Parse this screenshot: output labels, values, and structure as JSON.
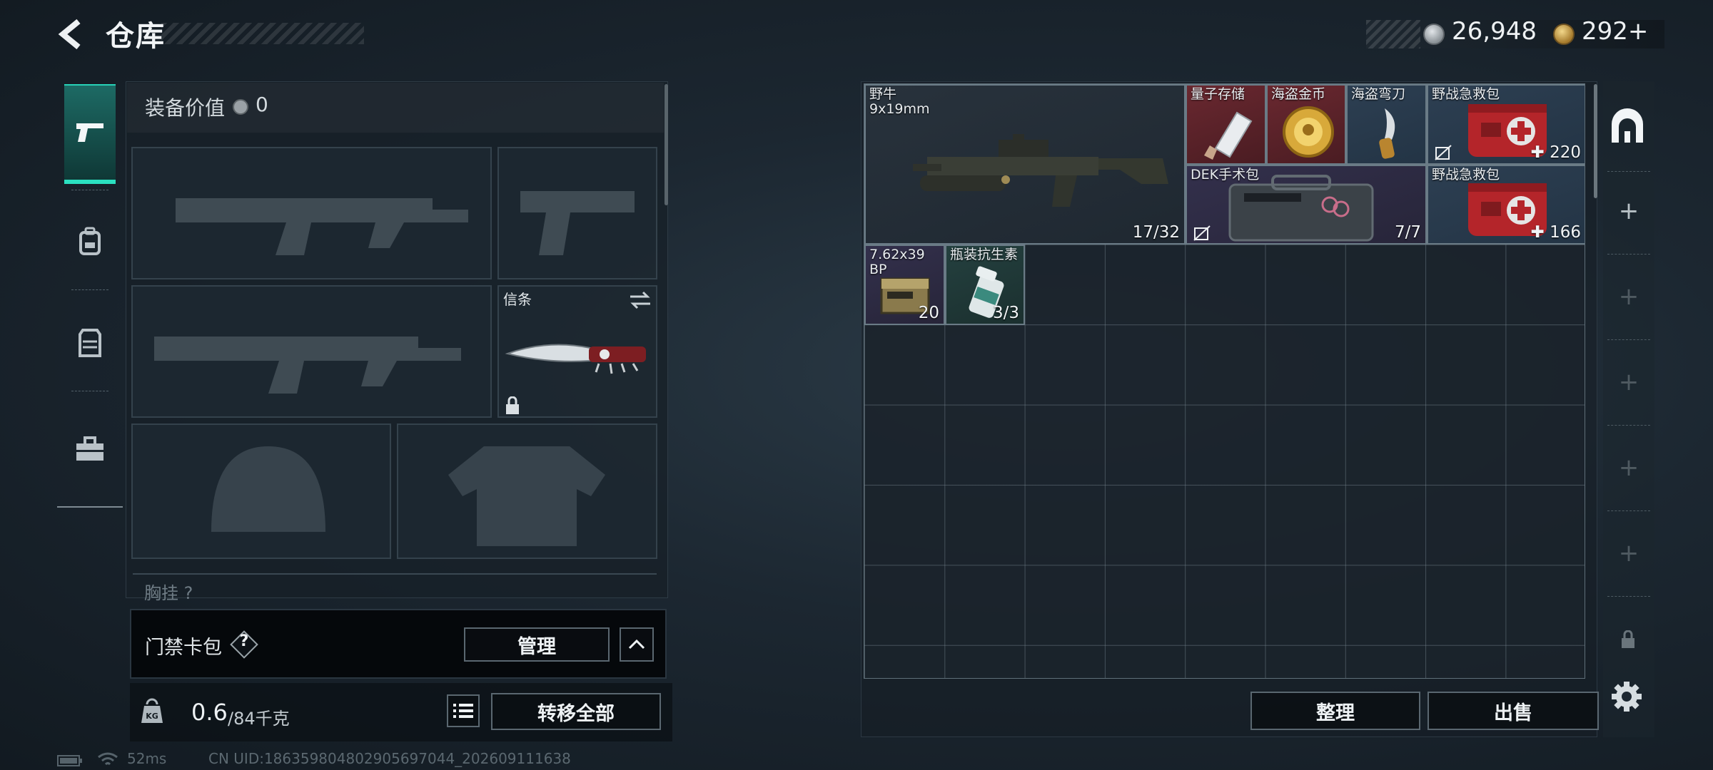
{
  "header": {
    "title": "仓库"
  },
  "currency": {
    "silver": "26,948",
    "gold": "292+"
  },
  "rail": {
    "tabs": [
      "weapons",
      "backpack",
      "armor",
      "toolbox"
    ]
  },
  "loadout": {
    "value_label": "装备价值",
    "value": "0",
    "melee_slot": {
      "label": "信条"
    },
    "section_peek": "胸挂 ?"
  },
  "card_pack": {
    "label": "门禁卡包",
    "help": "?",
    "manage_label": "管理"
  },
  "weight": {
    "current": "0.6",
    "max": "/84千克"
  },
  "transfer_all_label": "转移全部",
  "stash": {
    "items": [
      {
        "name": "野牛\n9x19mm",
        "count": "17/32"
      },
      {
        "name": "量子存储",
        "count": ""
      },
      {
        "name": "海盗金币",
        "count": ""
      },
      {
        "name": "海盗弯刀",
        "count": ""
      },
      {
        "name": "野战急救包",
        "count": "220"
      },
      {
        "name": "DEK手术包",
        "count": "7/7"
      },
      {
        "name": "野战急救包",
        "count": "166"
      },
      {
        "name": "7.62x39\nBP",
        "count": "20"
      },
      {
        "name": "瓶装抗生素",
        "count": "3/3"
      }
    ],
    "sort_label": "整理",
    "sell_label": "出售"
  },
  "status": {
    "ping": "52ms",
    "uid": "CN UID:186359804802905697044_202609111638"
  },
  "colors": {
    "accent": "#2be0c0",
    "rare_red": "#6a2830",
    "blue": "#2d3f52"
  }
}
